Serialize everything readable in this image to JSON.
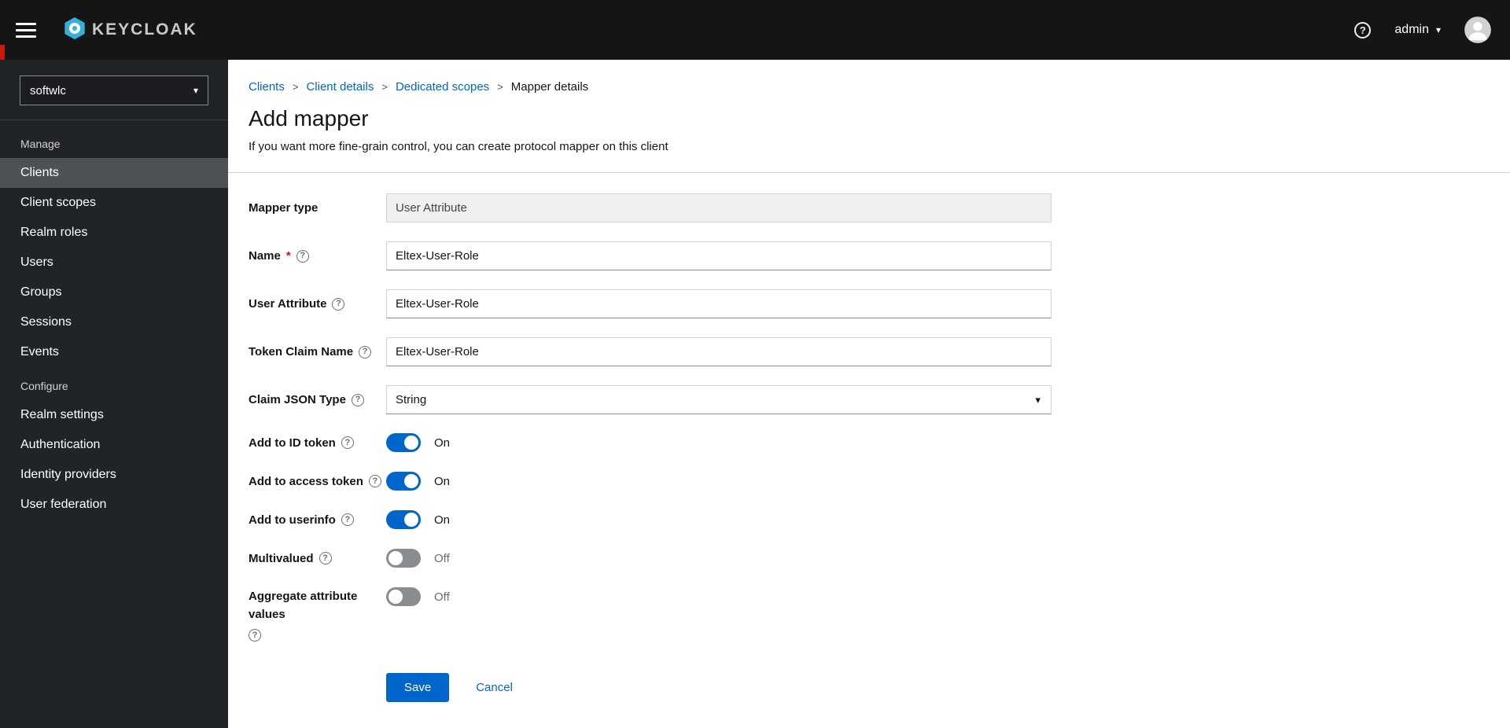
{
  "colors": {
    "primary": "#0066cc",
    "masthead_bg": "#151515",
    "sidebar_bg": "#212427",
    "sidebar_active_bg": "#4f5255",
    "link": "#0066cc",
    "toggle_on": "#0066cc",
    "toggle_off": "#8a8d90",
    "danger": "#c9190b",
    "logo_cyan": "#33b1db"
  },
  "icons": {
    "hamburger": "menu-bars",
    "help": "?",
    "caret_down": "▾",
    "breadcrumb_separator": ">"
  },
  "masthead": {
    "brand": "KEYCLOAK",
    "username": "admin"
  },
  "sidebar": {
    "realm": "softwlc",
    "manage_label": "Manage",
    "manage_items": [
      "Clients",
      "Client scopes",
      "Realm roles",
      "Users",
      "Groups",
      "Sessions",
      "Events"
    ],
    "configure_label": "Configure",
    "configure_items": [
      "Realm settings",
      "Authentication",
      "Identity providers",
      "User federation"
    ]
  },
  "breadcrumb": {
    "items": [
      "Clients",
      "Client details",
      "Dedicated scopes",
      "Mapper details"
    ]
  },
  "page": {
    "title": "Add mapper",
    "subtitle": "If you want more fine-grain control, you can create protocol mapper on this client"
  },
  "form": {
    "required_marker": "*",
    "mapper_type_label": "Mapper type",
    "mapper_type_value": "User Attribute",
    "name_label": "Name",
    "name_value": "Eltex-User-Role",
    "user_attribute_label": "User Attribute",
    "user_attribute_value": "Eltex-User-Role",
    "token_claim_label": "Token Claim Name",
    "token_claim_value": "Eltex-User-Role",
    "claim_json_type_label": "Claim JSON Type",
    "claim_json_type_value": "String",
    "toggles": [
      {
        "label": "Add to ID token",
        "state": "On"
      },
      {
        "label": "Add to access token",
        "state": "On"
      },
      {
        "label": "Add to userinfo",
        "state": "On"
      },
      {
        "label": "Multivalued",
        "state": "Off"
      },
      {
        "label": "Aggregate attribute values",
        "state": "Off"
      }
    ],
    "save_label": "Save",
    "cancel_label": "Cancel"
  }
}
